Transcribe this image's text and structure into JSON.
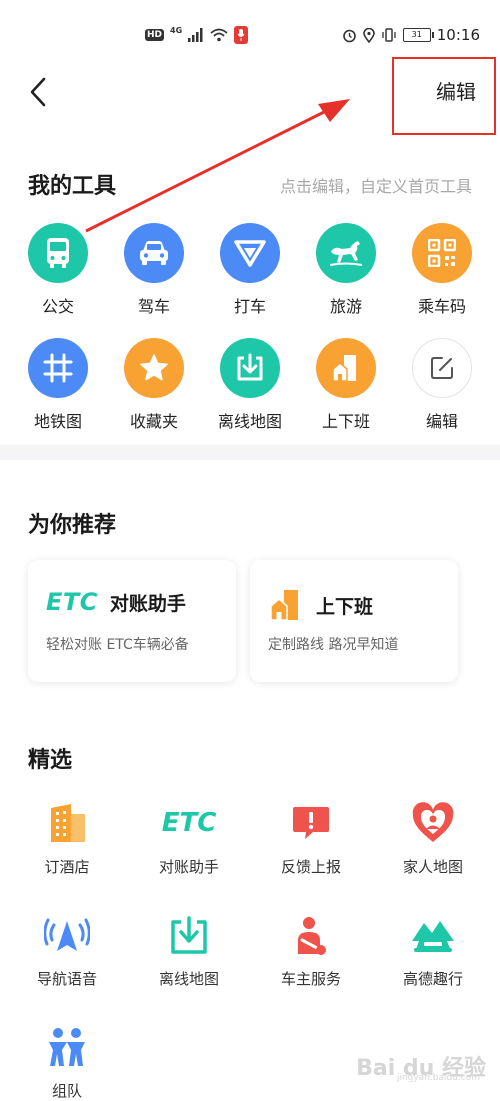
{
  "status_bar": {
    "hd": "HD",
    "network": "4G",
    "time": "10:16",
    "battery": "31"
  },
  "header": {
    "edit_label": "编辑"
  },
  "my_tools": {
    "title": "我的工具",
    "hint": "点击编辑，自定义首页工具",
    "items": [
      {
        "label": "公交",
        "icon": "bus-icon",
        "color": "#1ec7a8"
      },
      {
        "label": "驾车",
        "icon": "car-icon",
        "color": "#4c8bf5"
      },
      {
        "label": "打车",
        "icon": "taxi-icon",
        "color": "#4c8bf5"
      },
      {
        "label": "旅游",
        "icon": "horse-icon",
        "color": "#1ec7a8"
      },
      {
        "label": "乘车码",
        "icon": "qr-code-icon",
        "color": "#f7a233"
      },
      {
        "label": "地铁图",
        "icon": "subway-map-icon",
        "color": "#4c8bf5"
      },
      {
        "label": "收藏夹",
        "icon": "star-icon",
        "color": "#f7a233"
      },
      {
        "label": "离线地图",
        "icon": "offline-download-icon",
        "color": "#1ec7a8"
      },
      {
        "label": "上下班",
        "icon": "commute-icon",
        "color": "#f7a233"
      },
      {
        "label": "编辑",
        "icon": "edit-icon",
        "color": "#ffffff"
      }
    ]
  },
  "recommend": {
    "title": "为你推荐",
    "cards": [
      {
        "logo": "ETC",
        "title": "对账助手",
        "subtitle": "轻松对账 ETC车辆必备"
      },
      {
        "title": "上下班",
        "subtitle": "定制路线 路况早知道"
      }
    ]
  },
  "featured": {
    "title": "精选",
    "items": [
      {
        "label": "订酒店",
        "icon": "hotel-icon"
      },
      {
        "label": "对账助手",
        "icon": "etc-icon",
        "logo": "ETC"
      },
      {
        "label": "反馈上报",
        "icon": "feedback-icon"
      },
      {
        "label": "家人地图",
        "icon": "family-map-icon"
      },
      {
        "label": "导航语音",
        "icon": "navigation-voice-icon"
      },
      {
        "label": "离线地图",
        "icon": "offline-map-icon"
      },
      {
        "label": "车主服务",
        "icon": "car-owner-icon"
      },
      {
        "label": "高德趣行",
        "icon": "fun-travel-icon"
      },
      {
        "label": "组队",
        "icon": "team-icon"
      }
    ]
  },
  "colors": {
    "teal": "#1ec7a8",
    "blue": "#4c8bf5",
    "orange": "#f7a233",
    "red": "#e5312a",
    "annotation": "#e5312a"
  },
  "watermark": {
    "text": "Bai du 经验",
    "sub": "jingyan.baidu.com"
  }
}
